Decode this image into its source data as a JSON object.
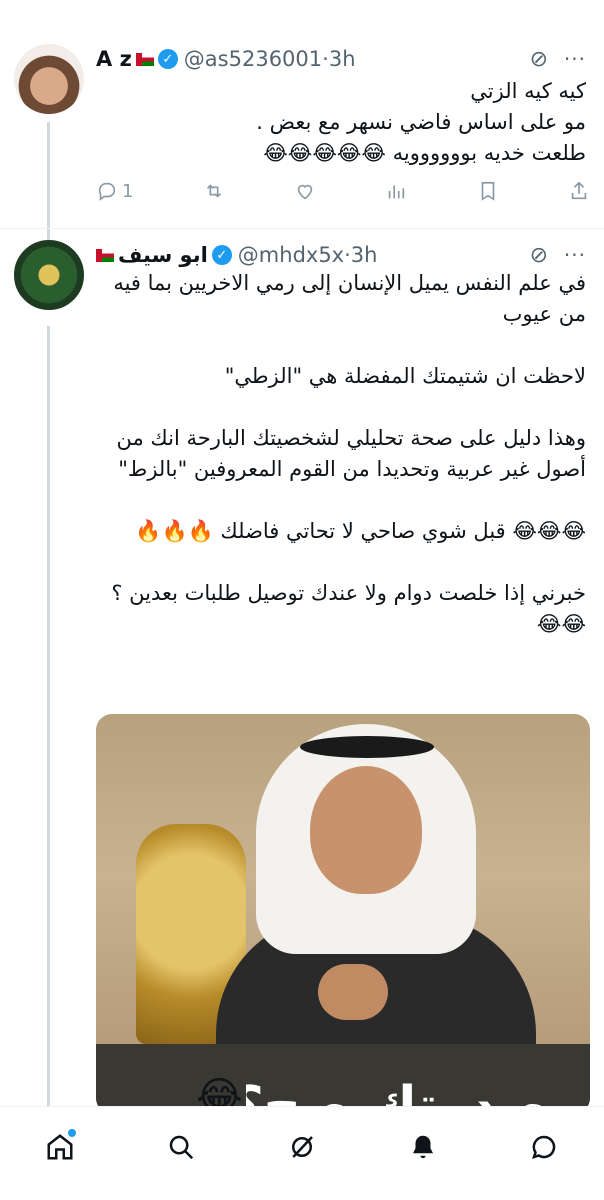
{
  "tweets": [
    {
      "name": "A z",
      "handle": "@as5236001",
      "time": "3h",
      "lines": [
        "كيه كيه الزتي",
        "مو على اساس فاضي نسهر مع بعض .",
        "طلعت خديه بوووووويه 😂😂😂😂😂"
      ],
      "reply_count": "1"
    },
    {
      "name": "ابو سيف",
      "handle": "@mhdx5x",
      "time": "3h",
      "paragraphs": [
        "في علم النفس يميل الإنسان إلى رمي الاخريين بما فيه من عيوب",
        "لاحظت ان شتيمتك المفضلة هي \"الزطي\"",
        "وهذا دليل على صحة تحليلي لشخصيتك البارحة انك من أصول غير عربية وتحديدا من القوم المعروفين \"بالزط\"",
        "😂😂😂 قبل شوي صاحي لا تحاتي فاضلك 🔥🔥🔥",
        "خبرني إذا خلصت دوام ولا عندك توصيل طلبات بعدين ؟😂😂"
      ],
      "media_caption": "صدوتك صح؟"
    }
  ],
  "icons": {
    "grok": "grok-icon",
    "more": "more-icon",
    "reply": "reply-icon",
    "retweet": "retweet-icon",
    "like": "like-icon",
    "views": "views-icon",
    "bookmark": "bookmark-icon",
    "share": "share-icon"
  },
  "tabbar": [
    "home",
    "search",
    "grok",
    "notifications",
    "messages"
  ],
  "colors": {
    "accent": "#1d9bf0",
    "text": "#0f1419",
    "secondary": "#536471"
  }
}
